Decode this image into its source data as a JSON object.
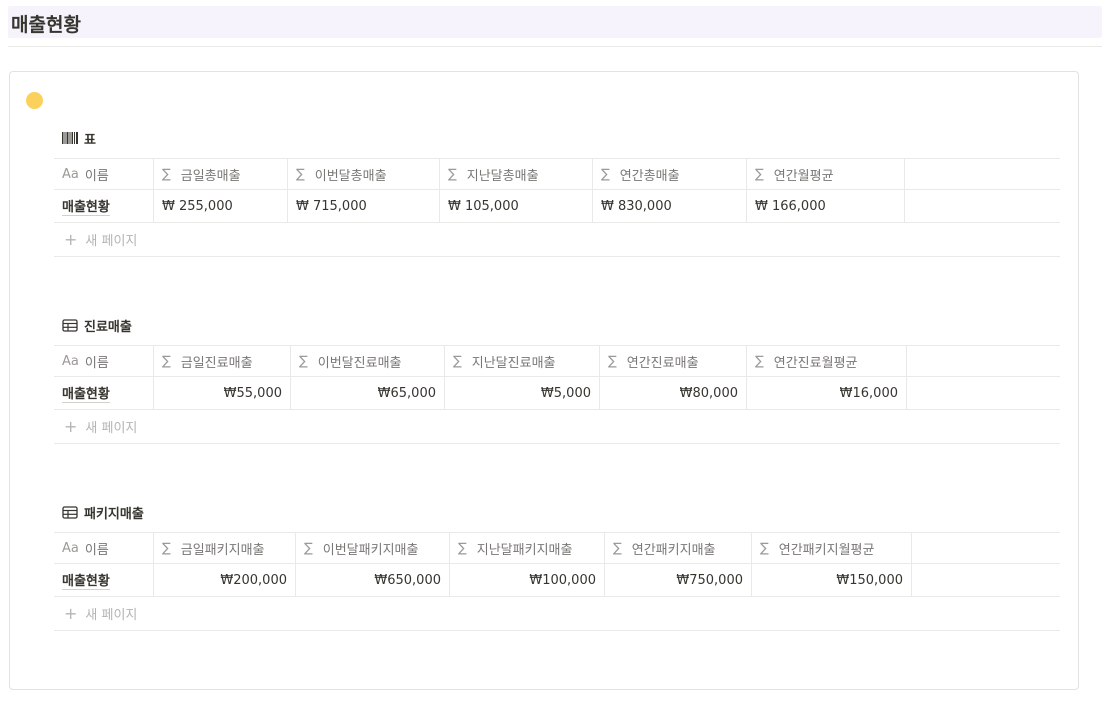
{
  "page": {
    "title": "매출현황"
  },
  "db1": {
    "title": "표",
    "icon": "barcode-icon",
    "headers": [
      "이름",
      "금일총매출",
      "이번달총매출",
      "지난달총매출",
      "연간총매출",
      "연간월평균"
    ],
    "row": [
      "매출현황",
      "₩ 255,000",
      "₩ 715,000",
      "₩ 105,000",
      "₩ 830,000",
      "₩ 166,000"
    ],
    "new_page": "새 페이지"
  },
  "db2": {
    "title": "진료매출",
    "icon": "table-icon",
    "headers": [
      "이름",
      "금일진료매출",
      "이번달진료매출",
      "지난달진료매출",
      "연간진료매출",
      "연간진료월평균"
    ],
    "row": [
      "매출현황",
      "₩55,000",
      "₩65,000",
      "₩5,000",
      "₩80,000",
      "₩16,000"
    ],
    "new_page": "새 페이지"
  },
  "db3": {
    "title": "패키지매출",
    "icon": "table-icon",
    "headers": [
      "이름",
      "금일패키지매출",
      "이번달패키지매출",
      "지난달패키지매출",
      "연간패키지매출",
      "연간패키지월평균"
    ],
    "row": [
      "매출현황",
      "₩200,000",
      "₩650,000",
      "₩100,000",
      "₩750,000",
      "₩150,000"
    ],
    "new_page": "새 페이지"
  },
  "icons": {
    "name_col": "Aa",
    "formula": "∑",
    "plus": "+"
  },
  "colors": {
    "header_bg": "#f6f3fc",
    "callout_dot": "#fbd15b"
  }
}
